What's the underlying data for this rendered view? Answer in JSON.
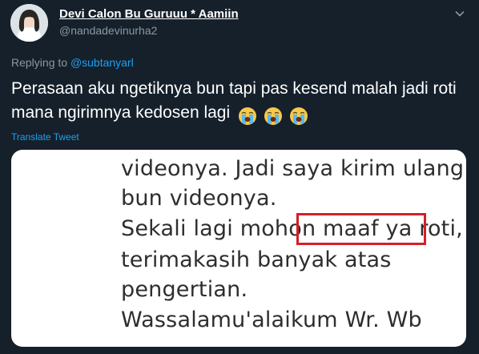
{
  "author": {
    "display_name": "Devi Calon Bu Guruuu * Aamiin",
    "handle": "@nandadevinurha2",
    "avatar_icon": "profile-avatar"
  },
  "tweet": {
    "replying_prefix": "Replying to ",
    "replying_to": "@subtanyarl",
    "text": "Perasaan aku ngetiknya bun tapi pas kesend malah jadi roti mana ngirimnya kedosen lagi",
    "emojis": [
      "loudly-crying-face",
      "loudly-crying-face",
      "loudly-crying-face"
    ],
    "translate_label": "Translate Tweet",
    "menu_icon": "chevron-down-icon"
  },
  "media": {
    "lines": [
      "videonya. Jadi saya kirim ulang",
      "bun videonya.",
      "Sekali lagi mohon maaf ya roti,",
      "terimakasih banyak atas",
      "pengertian.",
      "Wassalamu'alaikum Wr. Wb"
    ],
    "highlight_color": "#d51f26"
  },
  "colors": {
    "background": "#15202b",
    "accent": "#1da1f2",
    "secondary_text": "#8899a6"
  }
}
